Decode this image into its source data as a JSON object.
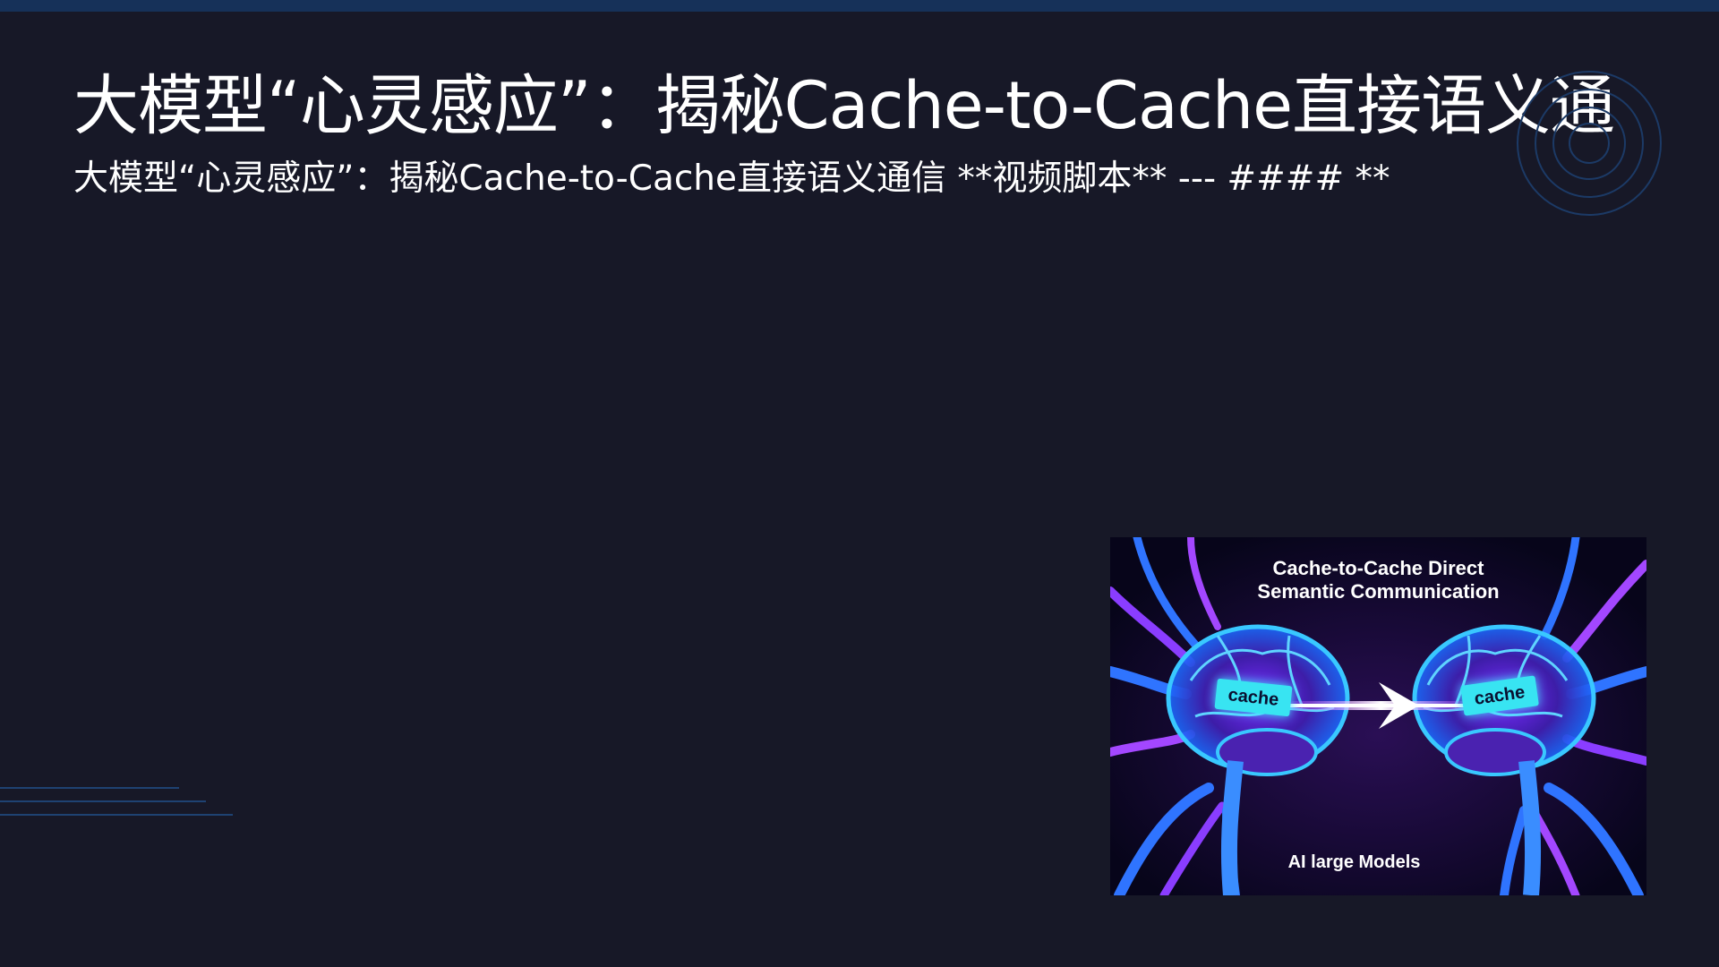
{
  "slide": {
    "title": "大模型“心灵感应”：揭秘Cache-to-Cache直接语义通",
    "subtitle": "大模型“心灵感应”：揭秘Cache-to-Cache直接语义通信 **视频脚本** --- #### **"
  },
  "figure": {
    "title_line1": "Cache-to-Cache Direct",
    "title_line2": "Semantic Communication",
    "left_tag": "cache",
    "right_tag": "cache",
    "caption": "AI large Models"
  },
  "colors": {
    "background": "#171827",
    "top_bar": "#163159",
    "accent_cyan": "#38e4f2",
    "accent_purple": "#a347ff",
    "network_blue": "#2f74ff"
  }
}
